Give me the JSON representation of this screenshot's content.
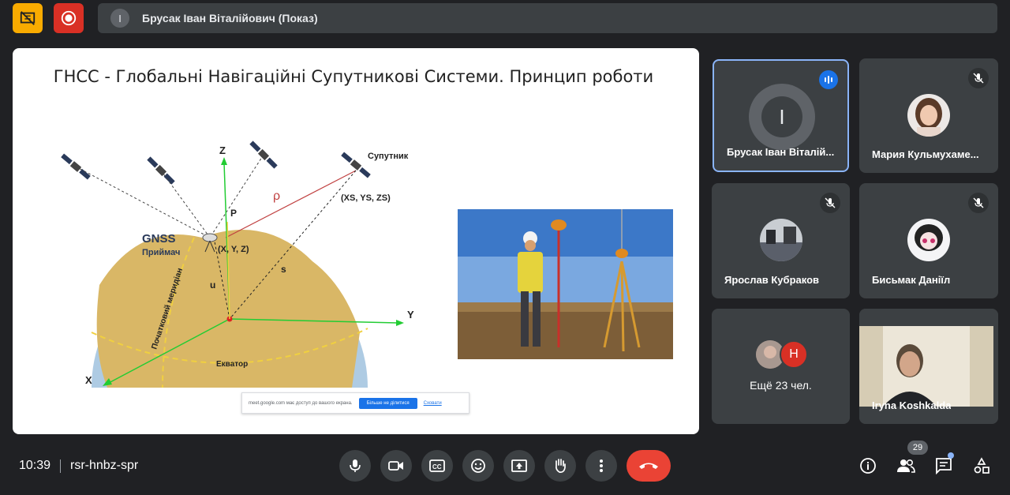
{
  "top_bar": {
    "presenter_initial": "I",
    "presenter_label": "Брусак Іван Віталійович (Показ)"
  },
  "slide": {
    "title": "ГНСС - Глобальні Навігаційні Супутникові Системи. Принцип роботи",
    "diagram": {
      "satellite_label": "Супутник",
      "sat_coords": "(XS, YS, ZS)",
      "receiver_label": "GNSS",
      "receiver_sub": "Приймач",
      "receiver_coords": "(X, Y, Z)",
      "meridian_label": "Початковий меридіан",
      "equator_label": "Екватор",
      "axis_x": "X",
      "axis_y": "Y",
      "axis_z": "Z",
      "label_p": "P",
      "label_u": "u",
      "label_s": "s",
      "label_rho": "ρ"
    },
    "share_banner": {
      "text": "meet.google.com має доступ до вашого екрана.",
      "stop_label": "Більше не ділитися",
      "hide_label": "Сховати"
    }
  },
  "participants": [
    {
      "name": "Брусак Іван Віталій...",
      "initial": "I",
      "speaking": true
    },
    {
      "name": "Мария Кульмухаме...",
      "muted": true
    },
    {
      "name": "Ярослав Кубраков",
      "muted": true
    },
    {
      "name": "Бисьмак Даніїл",
      "muted": true
    },
    {
      "more_label": "Ещё 23 чел.",
      "initial": "Н"
    },
    {
      "name": "Iryna Koshkalda"
    }
  ],
  "bottom": {
    "time": "10:39",
    "meeting_code": "rsr-hnbz-spr",
    "people_count": "29"
  },
  "colors": {
    "background": "#202124",
    "tile": "#3c4043",
    "accent_blue": "#1a73e8",
    "end_call_red": "#ea4335",
    "warn_yellow": "#f9ab00",
    "record_red": "#d93025"
  },
  "icons": {
    "warn": "present-off-icon",
    "record": "record-icon",
    "mic": "mic-icon",
    "camera": "camera-icon",
    "captions": "captions-icon",
    "emoji": "emoji-icon",
    "present": "present-icon",
    "hand": "raise-hand-icon",
    "more": "more-vert-icon",
    "end_call": "end-call-icon",
    "info": "info-icon",
    "people": "people-icon",
    "chat": "chat-icon",
    "activities": "activities-icon"
  }
}
